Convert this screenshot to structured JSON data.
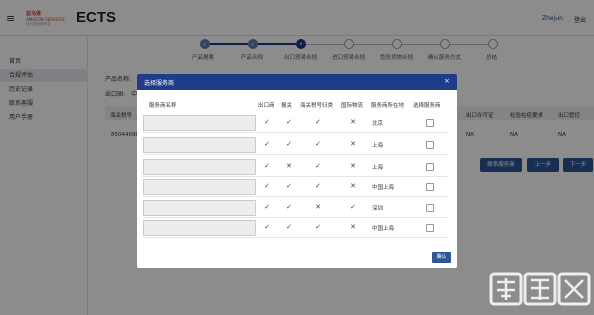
{
  "header": {
    "menu_icon": "menu-icon",
    "logo_top": "亚马逊",
    "logo_mid": "AMAZON SERVICES",
    "logo_bot": "亚马逊全球开店",
    "app_title": "ECTS",
    "user_name": "Zhejun",
    "logout_label": "登出"
  },
  "sidebar": {
    "items": [
      {
        "label": "首页",
        "active": false
      },
      {
        "label": "合规评估",
        "active": true
      },
      {
        "label": "历史记录",
        "active": false
      },
      {
        "label": "联系客服",
        "active": false
      },
      {
        "label": "用户手册",
        "active": false
      }
    ]
  },
  "stepper": {
    "steps": [
      {
        "label": "产品报案",
        "state": "done"
      },
      {
        "label": "产品合规",
        "state": "done"
      },
      {
        "label": "出口贸易合规",
        "state": "current"
      },
      {
        "label": "进口贸易合规",
        "state": "todo"
      },
      {
        "label": "危险货物合规",
        "state": "todo"
      },
      {
        "label": "确认服务方式",
        "state": "todo"
      },
      {
        "label": "总结",
        "state": "todo"
      }
    ]
  },
  "background": {
    "product_name_label": "产品名称:",
    "export_country_label": "出口国:",
    "export_country_partial": "中",
    "customs_code_header": "海关税号",
    "customs_code_value": "85044090",
    "columns_right": [
      "出口许可证",
      "检验检疫要求",
      "出口管控"
    ],
    "row_values_right": [
      "NA",
      "NA",
      "NA"
    ],
    "buttons": {
      "contact_provider": "联系服务商",
      "prev": "上一步",
      "next": "下一步"
    }
  },
  "dialog": {
    "title": "选择服务商",
    "close_icon": "close-icon",
    "columns": [
      "服务商名称",
      "出口商",
      "报关",
      "海关税号归类",
      "国际物流",
      "服务商所在地",
      "选择服务商"
    ],
    "rows": [
      {
        "name": "",
        "exporter": "✓",
        "customs": "✓",
        "hs_code": "✓",
        "logistics": "✕",
        "location": "北京",
        "selected": false
      },
      {
        "name": "",
        "exporter": "✓",
        "customs": "✓",
        "hs_code": "✓",
        "logistics": "✕",
        "location": "上海",
        "selected": false
      },
      {
        "name": "",
        "exporter": "✓",
        "customs": "✕",
        "hs_code": "✓",
        "logistics": "✕",
        "location": "上海",
        "selected": false
      },
      {
        "name": "",
        "exporter": "✓",
        "customs": "✓",
        "hs_code": "✓",
        "logistics": "✕",
        "location": "中国上海",
        "selected": false
      },
      {
        "name": "",
        "exporter": "✓",
        "customs": "✓",
        "hs_code": "✕",
        "logistics": "✓",
        "location": "深圳",
        "selected": false
      },
      {
        "name": "",
        "exporter": "✓",
        "customs": "✓",
        "hs_code": "✓",
        "logistics": "✕",
        "location": "中国上海",
        "selected": false
      }
    ],
    "confirm_label": "确认"
  },
  "colors": {
    "primary": "#1f3c88",
    "button": "#2e5597",
    "overlay": "rgba(0,0,0,0.45)"
  }
}
